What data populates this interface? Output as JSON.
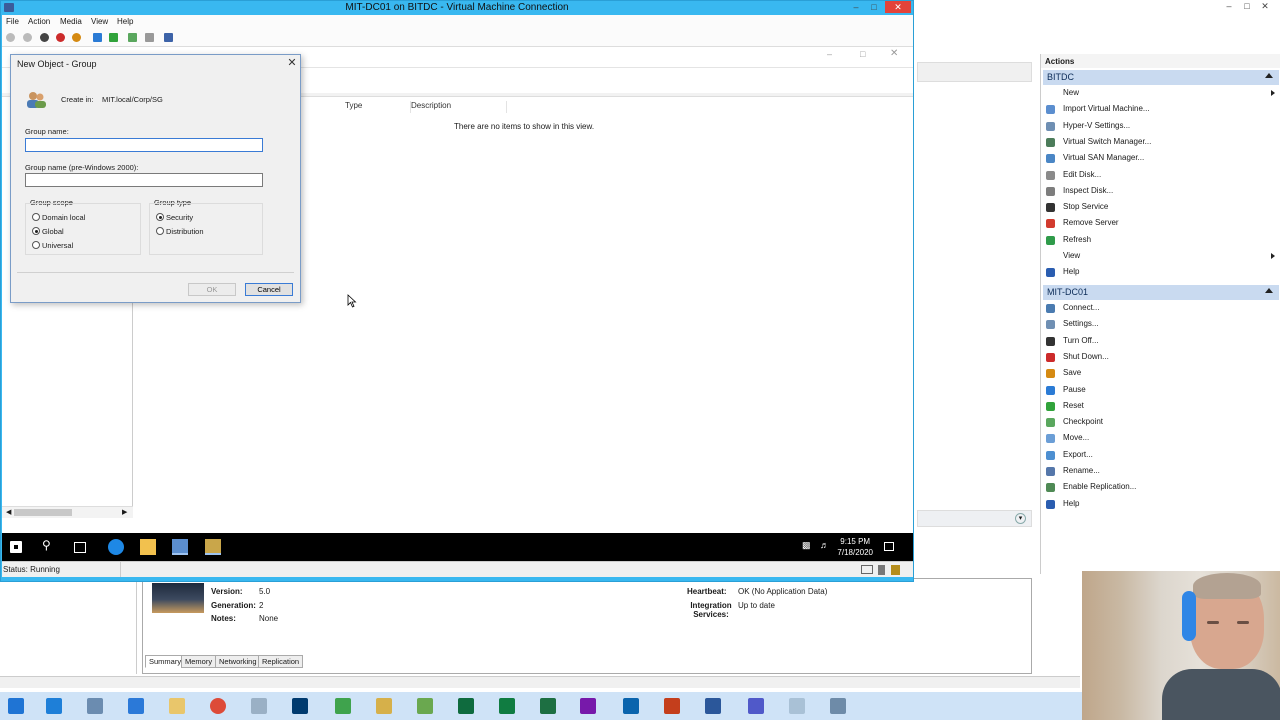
{
  "vm_window": {
    "title": "MIT-DC01 on BITDC - Virtual Machine Connection",
    "menu": [
      "File",
      "Action",
      "Media",
      "View",
      "Help"
    ],
    "status": "Status: Running"
  },
  "dialog": {
    "title": "New Object - Group",
    "create_in_label": "Create in:",
    "create_in_value": "MIT.local/Corp/SG",
    "group_name_label": "Group name:",
    "group_name_value": "",
    "pre2000_label": "Group name (pre-Windows 2000):",
    "pre2000_value": "",
    "scope_label": "Group scope",
    "scope_options": [
      "Domain local",
      "Global",
      "Universal"
    ],
    "scope_selected": "Global",
    "type_label": "Group type",
    "type_options": [
      "Security",
      "Distribution"
    ],
    "type_selected": "Security",
    "ok_label": "OK",
    "cancel_label": "Cancel"
  },
  "aduc_list": {
    "columns": [
      "Type",
      "Description"
    ],
    "empty_message": "There are no items to show in this view."
  },
  "guest_clock": {
    "time": "9:15 PM",
    "date": "7/18/2020"
  },
  "actions_pane": {
    "header": "Actions",
    "sections": [
      {
        "title": "BITDC",
        "items": [
          {
            "label": "New",
            "submenu": true,
            "icon": "none"
          },
          {
            "label": "Import Virtual Machine...",
            "icon": "import-icon"
          },
          {
            "label": "Hyper-V Settings...",
            "icon": "settings-icon"
          },
          {
            "label": "Virtual Switch Manager...",
            "icon": "switch-icon"
          },
          {
            "label": "Virtual SAN Manager...",
            "icon": "san-icon"
          },
          {
            "label": "Edit Disk...",
            "icon": "edit-disk-icon"
          },
          {
            "label": "Inspect Disk...",
            "icon": "inspect-disk-icon"
          },
          {
            "label": "Stop Service",
            "icon": "stop-icon"
          },
          {
            "label": "Remove Server",
            "icon": "remove-icon"
          },
          {
            "label": "Refresh",
            "icon": "refresh-icon"
          },
          {
            "label": "View",
            "submenu": true,
            "icon": "none"
          },
          {
            "label": "Help",
            "icon": "help-icon"
          }
        ]
      },
      {
        "title": "MIT-DC01",
        "items": [
          {
            "label": "Connect...",
            "icon": "connect-icon"
          },
          {
            "label": "Settings...",
            "icon": "settings-icon"
          },
          {
            "label": "Turn Off...",
            "icon": "turn-off-icon"
          },
          {
            "label": "Shut Down...",
            "icon": "shutdown-icon"
          },
          {
            "label": "Save",
            "icon": "save-icon"
          },
          {
            "label": "Pause",
            "icon": "pause-icon"
          },
          {
            "label": "Reset",
            "icon": "reset-icon"
          },
          {
            "label": "Checkpoint",
            "icon": "checkpoint-icon"
          },
          {
            "label": "Move...",
            "icon": "move-icon"
          },
          {
            "label": "Export...",
            "icon": "export-icon"
          },
          {
            "label": "Rename...",
            "icon": "rename-icon"
          },
          {
            "label": "Enable Replication...",
            "icon": "replication-icon"
          },
          {
            "label": "Help",
            "icon": "help-icon"
          }
        ]
      }
    ]
  },
  "vm_details": {
    "version_label": "Version:",
    "version_value": "5.0",
    "generation_label": "Generation:",
    "generation_value": "2",
    "notes_label": "Notes:",
    "notes_value": "None",
    "heartbeat_label": "Heartbeat:",
    "heartbeat_value": "OK (No Application Data)",
    "integration_label": "Integration Services:",
    "integration_value": "Up to date",
    "tabs": [
      "Summary",
      "Memory",
      "Networking",
      "Replication"
    ]
  },
  "colors": {
    "vm_frame": "#39b8f0",
    "section_header": "#c9daf0",
    "host_taskbar": "#cfe3f7",
    "guest_taskbar": "#000000"
  }
}
